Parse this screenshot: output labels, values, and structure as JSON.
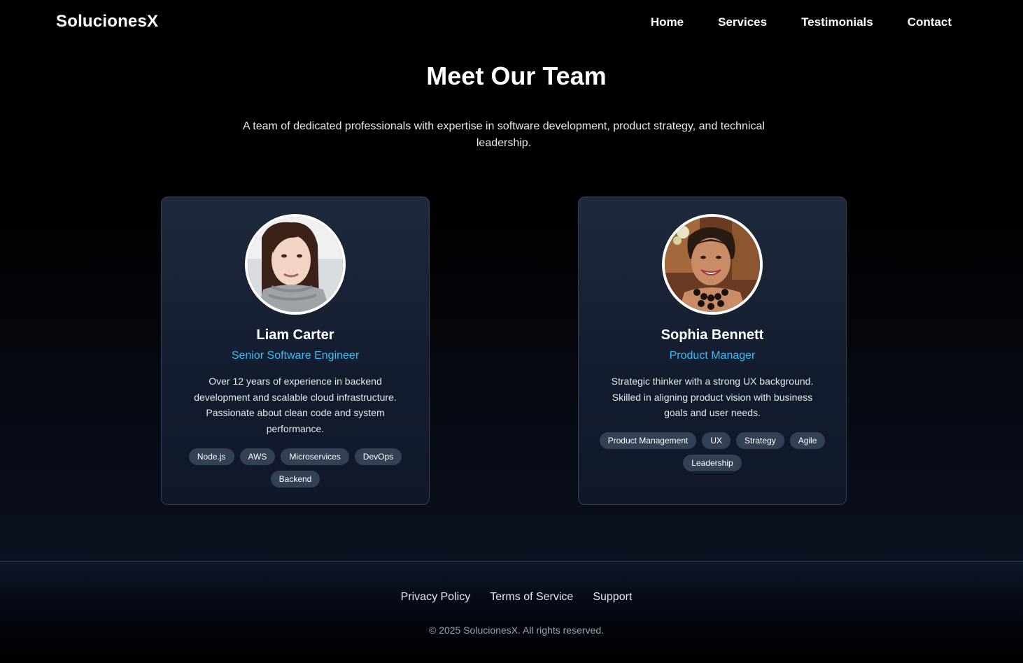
{
  "brand": "SolucionesX",
  "nav": [
    "Home",
    "Services",
    "Testimonials",
    "Contact"
  ],
  "hero": {
    "title": "Meet Our Team",
    "subtitle": "A team of dedicated professionals with expertise in software development, product strategy, and technical leadership."
  },
  "team": [
    {
      "name": "Liam Carter",
      "role": "Senior Software Engineer",
      "bio": "Over 12 years of experience in backend development and scalable cloud infrastructure. Passionate about clean code and system performance.",
      "tags": [
        "Node.js",
        "AWS",
        "Microservices",
        "DevOps",
        "Backend"
      ],
      "avatar_icon": "portrait-photo"
    },
    {
      "name": "Sophia Bennett",
      "role": "Product Manager",
      "bio": "Strategic thinker with a strong UX background. Skilled in aligning product vision with business goals and user needs.",
      "tags": [
        "Product Management",
        "UX",
        "Strategy",
        "Agile",
        "Leadership"
      ],
      "avatar_icon": "portrait-photo"
    }
  ],
  "footer": {
    "links": [
      "Privacy Policy",
      "Terms of Service",
      "Support"
    ],
    "copyright": "© 2025 SolucionesX. All rights reserved."
  },
  "colors": {
    "accent": "#38bdf8",
    "card_bg": "#1e293b",
    "tag_bg": "#334155",
    "page_bg": "#000000"
  }
}
